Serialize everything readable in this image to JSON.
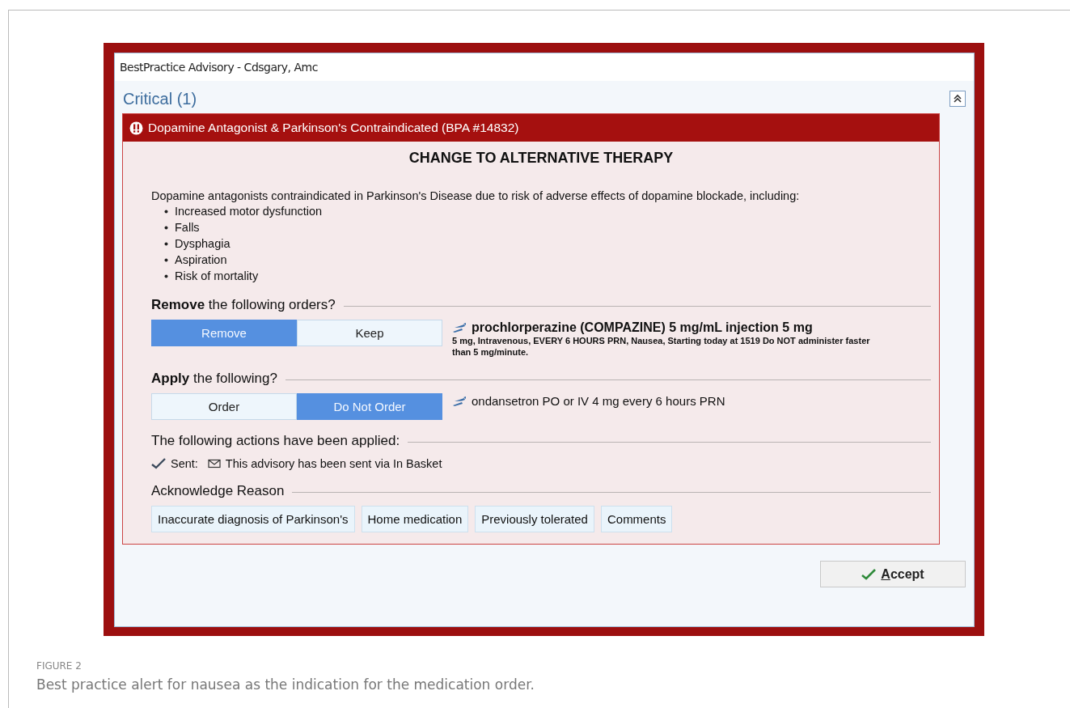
{
  "window": {
    "title": "BestPractice Advisory - Cdsgary, Amc"
  },
  "section": {
    "title": "Critical (1)",
    "expanded": true
  },
  "alert": {
    "title": "Dopamine Antagonist & Parkinson's Contraindicated (BPA #14832)",
    "heading": "CHANGE TO ALTERNATIVE THERAPY",
    "message": "Dopamine antagonists contraindicated in Parkinson's Disease due to risk of adverse effects of dopamine blockade, including:",
    "bullets": [
      "Increased motor dysfunction",
      "Falls",
      "Dysphagia",
      "Aspiration",
      "Risk of mortality"
    ]
  },
  "groups": [
    {
      "kind": "choice",
      "title": "**Remove** the following orders?",
      "options": [
        {
          "label": "Remove",
          "selected": true
        },
        {
          "label": "Keep",
          "selected": false
        }
      ],
      "order": {
        "name": "prochlorperazine (COMPAZINE) 5 mg/mL injection 5 mg",
        "details": "5 mg, Intravenous, EVERY 6 HOURS PRN, Nausea, Starting today at 1519 Do NOT administer faster than 5 mg/minute."
      }
    },
    {
      "kind": "choice",
      "title": "**Apply** the following?",
      "options": [
        {
          "label": "Order",
          "selected": false
        },
        {
          "label": "Do Not Order",
          "selected": true
        }
      ],
      "order": {
        "name": "ondansetron PO or IV 4 mg every 6 hours PRN"
      }
    },
    {
      "kind": "actions",
      "title": "The following actions have been applied:",
      "items": [
        {
          "label": "Sent:",
          "text": "This advisory has been sent via In Basket"
        }
      ]
    },
    {
      "kind": "reasons",
      "title": "Acknowledge Reason",
      "buttons": [
        "Inaccurate diagnosis of Parkinson's",
        "Home medication",
        "Previously tolerated",
        "Comments"
      ]
    }
  ],
  "footer": {
    "accept": "Accept"
  },
  "caption": {
    "label": "FIGURE 2",
    "text": "Best practice alert for nausea as the indication for the medication order."
  }
}
